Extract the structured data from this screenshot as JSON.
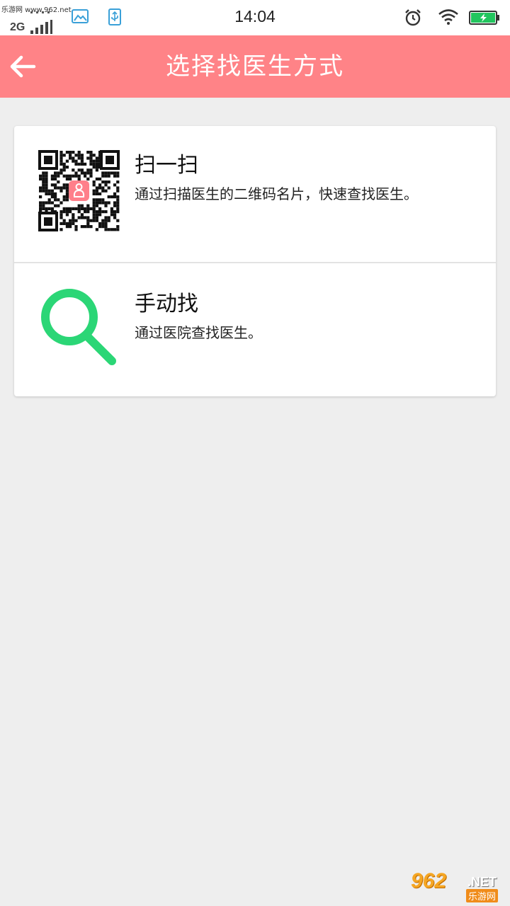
{
  "status_bar": {
    "watermark_text": "乐游网 www.962.net",
    "network_top": "4G",
    "network_bottom": "2G",
    "time": "14:04",
    "icons": [
      "gallery-icon",
      "usb-icon",
      "alarm-icon",
      "wifi-icon",
      "battery-charging-icon"
    ]
  },
  "app_bar": {
    "title": "选择找医生方式",
    "back_icon": "arrow-left-icon",
    "background": "#ff8387"
  },
  "options": [
    {
      "title": "扫一扫",
      "description": "通过扫描医生的二维码名片，快速查找医生。",
      "icon": "qr-code-icon"
    },
    {
      "title": "手动找",
      "description": "通过医院查找医生。",
      "icon": "search-icon",
      "icon_color": "#2bd676"
    }
  ],
  "watermark": {
    "logo": "962",
    "suffix": ".NET",
    "name": "乐游网"
  }
}
